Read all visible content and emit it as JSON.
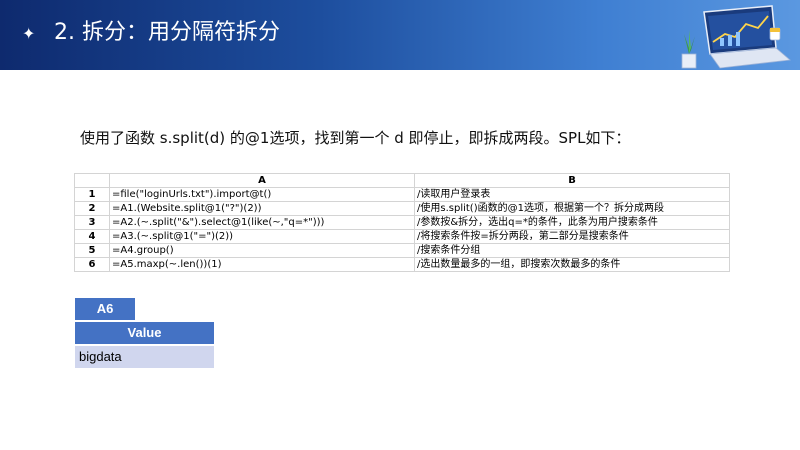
{
  "header": {
    "bullet": "✦",
    "title": "2. 拆分：用分隔符拆分"
  },
  "intro": "使用了函数 s.split(d) 的@1选项，找到第一个 d 即停止，即拆成两段。SPL如下：",
  "grid": {
    "col_a": "A",
    "col_b": "B",
    "rows": [
      {
        "n": "1",
        "a": "=file(\"loginUrls.txt\").import@t()",
        "b": "/读取用户登录表"
      },
      {
        "n": "2",
        "a": "=A1.(Website.split@1(\"?\")(2))",
        "b": "/使用s.split()函数的@1选项，根据第一个？拆分成两段"
      },
      {
        "n": "3",
        "a": "=A2.(~.split(\"&\").select@1(like(~,\"q=*\")))",
        "b": "/参数按&拆分，选出q=*的条件，此条为用户搜索条件"
      },
      {
        "n": "4",
        "a": "=A3.(~.split@1(\"=\")(2))",
        "b": "/将搜索条件按=拆分两段，第二部分是搜索条件"
      },
      {
        "n": "5",
        "a": "=A4.group()",
        "b": "/搜索条件分组"
      },
      {
        "n": "6",
        "a": "=A5.maxp(~.len())(1)",
        "b": "/选出数量最多的一组，即搜索次数最多的条件"
      }
    ]
  },
  "result": {
    "cell": "A6",
    "header": "Value",
    "value": "bigdata"
  }
}
